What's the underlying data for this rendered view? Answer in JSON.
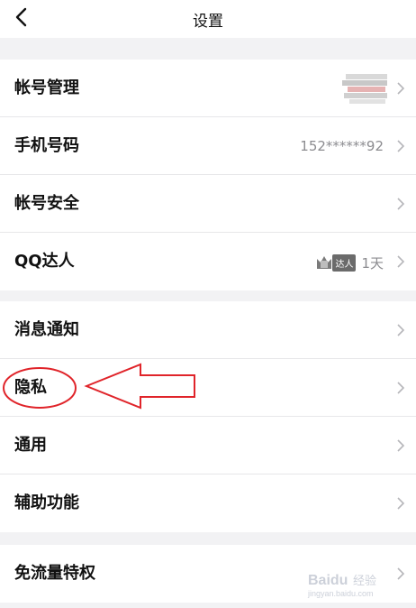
{
  "header": {
    "title": "设置"
  },
  "group1": [
    {
      "label": "帐号管理",
      "value": ""
    },
    {
      "label": "手机号码",
      "value": "152******92"
    },
    {
      "label": "帐号安全",
      "value": ""
    },
    {
      "label": "QQ达人",
      "badge_text": "达人",
      "days": "1天"
    }
  ],
  "group2": [
    {
      "label": "消息通知"
    },
    {
      "label": "隐私"
    },
    {
      "label": "通用"
    },
    {
      "label": "辅助功能"
    }
  ],
  "group3": [
    {
      "label": "免流量特权"
    }
  ],
  "watermark": {
    "brand": "Baidu",
    "sub": "经验",
    "url": "jingyan.baidu.com"
  },
  "colors": {
    "annotation": "#e0242a",
    "divider": "#e7e7e9",
    "secondary_text": "#8c8c90"
  }
}
